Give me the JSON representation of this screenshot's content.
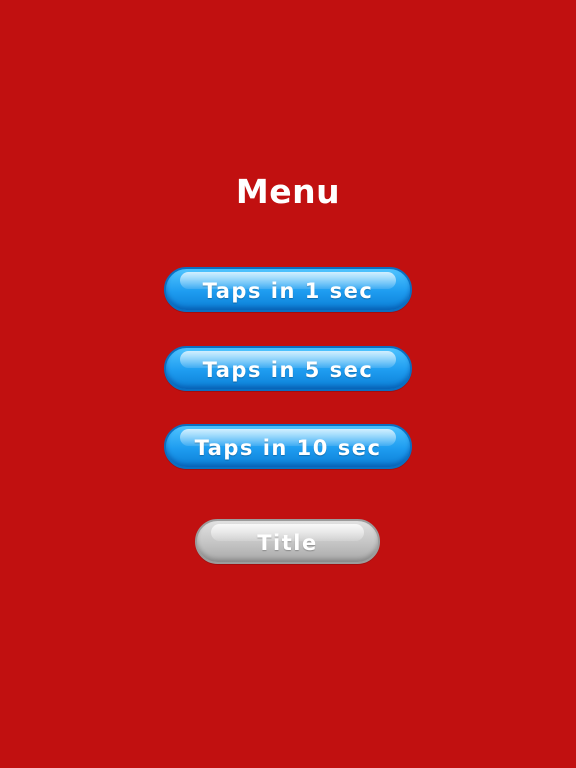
{
  "screen": {
    "background_color": "#c11010",
    "title": "Menu"
  },
  "buttons": [
    {
      "label": "Taps in 1 sec",
      "color": "#1e9cf0"
    },
    {
      "label": "Taps in 5 sec",
      "color": "#1e9cf0"
    },
    {
      "label": "Taps in 10 sec",
      "color": "#1e9cf0"
    },
    {
      "label": "Title",
      "color": "#c4c4c4"
    }
  ]
}
